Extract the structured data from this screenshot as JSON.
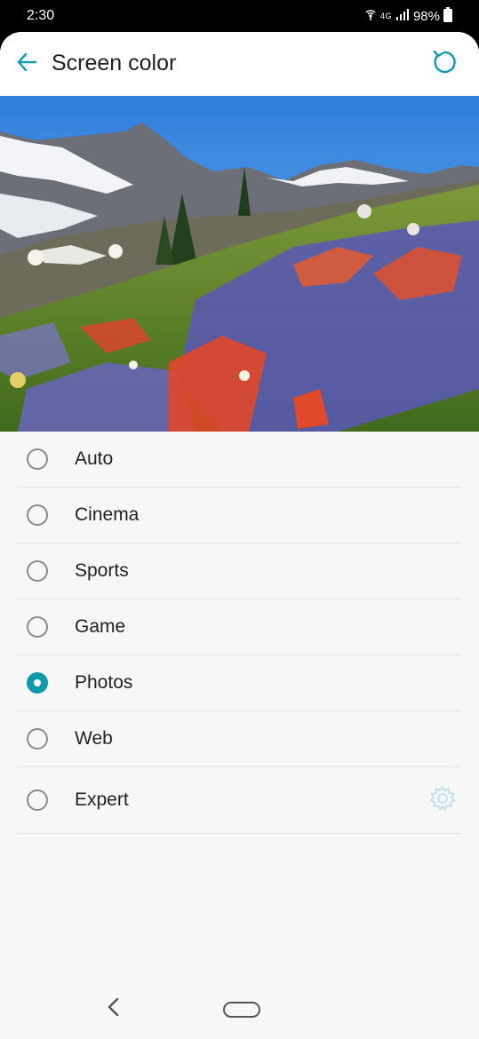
{
  "status_bar": {
    "time": "2:30",
    "network": "4G",
    "battery": "98%",
    "icons": [
      "hotspot-icon",
      "signal-icon",
      "battery-icon"
    ]
  },
  "header": {
    "title": "Screen color",
    "back_icon": "arrow-left-icon",
    "reset_icon": "reset-icon"
  },
  "preview": {
    "description_icon": "landscape-preview-image"
  },
  "options": [
    {
      "label": "Auto",
      "selected": false
    },
    {
      "label": "Cinema",
      "selected": false
    },
    {
      "label": "Sports",
      "selected": false
    },
    {
      "label": "Game",
      "selected": false
    },
    {
      "label": "Photos",
      "selected": true
    },
    {
      "label": "Web",
      "selected": false
    },
    {
      "label": "Expert",
      "selected": false,
      "settings_icon": "gear-icon"
    }
  ],
  "nav_bar": {
    "back_icon": "nav-back-icon",
    "home_icon": "nav-home-icon"
  },
  "colors": {
    "accent": "#1199aa",
    "background": "#f7f7f7",
    "header": "#ffffff"
  }
}
